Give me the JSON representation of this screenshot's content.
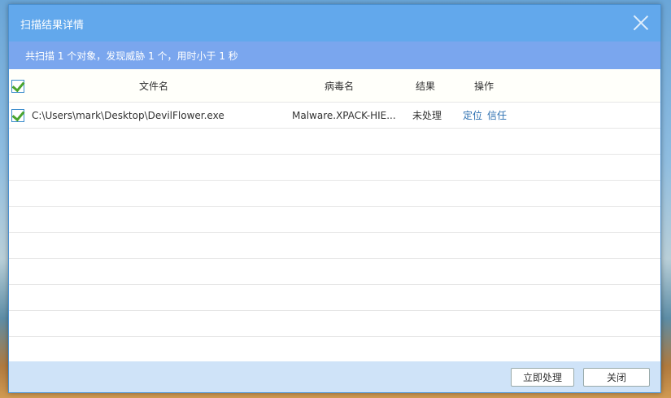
{
  "dialog": {
    "title": "扫描结果详情",
    "summary": "共扫描 1 个对象，发现威胁 1 个，用时小于 1 秒"
  },
  "table": {
    "headers": {
      "file": "文件名",
      "virus": "病毒名",
      "result": "结果",
      "action": "操作"
    },
    "rows": [
      {
        "checked": true,
        "file": "C:\\Users\\mark\\Desktop\\DevilFlower.exe",
        "virus": "Malware.XPACK-HIE...",
        "result": "未处理",
        "actions": [
          "定位",
          "信任"
        ]
      }
    ]
  },
  "footer": {
    "process_label": "立即处理",
    "close_label": "关闭"
  }
}
